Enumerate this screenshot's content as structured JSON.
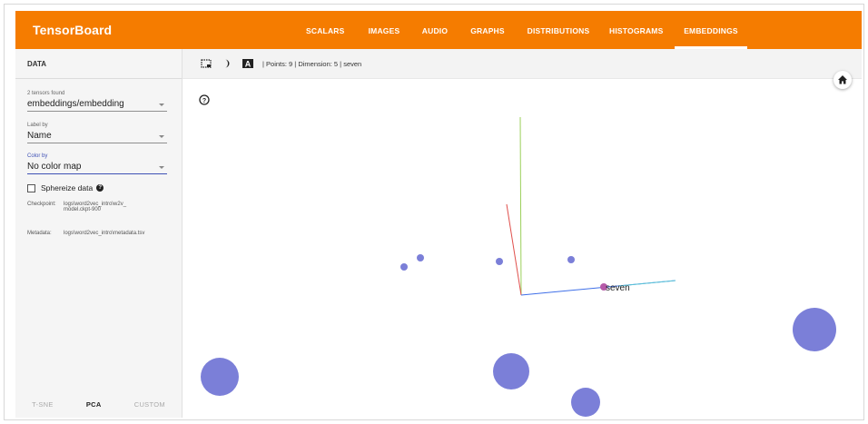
{
  "app": {
    "brand": "TensorBoard",
    "tabs": [
      {
        "label": "SCALARS"
      },
      {
        "label": "IMAGES"
      },
      {
        "label": "AUDIO"
      },
      {
        "label": "GRAPHS"
      },
      {
        "label": "DISTRIBUTIONS"
      },
      {
        "label": "HISTOGRAMS"
      },
      {
        "label": "EMBEDDINGS",
        "active": true
      }
    ],
    "accent_color": "#f57c00"
  },
  "sidebar": {
    "title": "DATA",
    "tensors": {
      "label": "2 tensors found",
      "value": "embeddings/embedding"
    },
    "label_by": {
      "label": "Label by",
      "value": "Name"
    },
    "color_by": {
      "label": "Color by",
      "value": "No color map"
    },
    "sphereize": {
      "label": "Sphereize data",
      "checked": false
    },
    "checkpoint": {
      "key": "Checkpoint:",
      "value": "logs\\word2vec_intro\\w2v_\nmodel.ckpt-900"
    },
    "metadata": {
      "key": "Metadata:",
      "value": "logs\\word2vec_intro\\metadata.tsv"
    },
    "projection_tabs": [
      {
        "label": "T-SNE"
      },
      {
        "label": "PCA",
        "active": true
      },
      {
        "label": "CUSTOM"
      }
    ]
  },
  "toolbar": {
    "icons": [
      "select-rectangle-icon",
      "night-mode-icon",
      "label-toggle-icon"
    ],
    "status": "| Points: 9 | Dimension: 5 | seven",
    "home_icon": "home-icon",
    "help_icon": "help-icon"
  },
  "projection": {
    "selected_label": "seven",
    "point_color": "#7b7fd8",
    "axis_colors": {
      "x": "#3f6fe8",
      "y": "#9bd05a",
      "z": "#e0504c"
    },
    "points_count": 9
  }
}
